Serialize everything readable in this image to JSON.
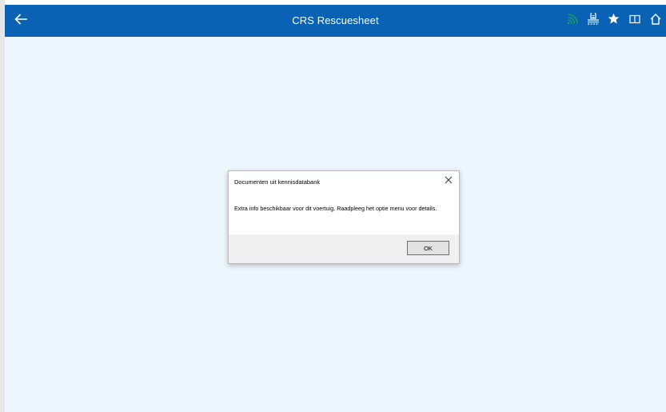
{
  "app": {
    "title": "CRS Rescuesheet",
    "accent_color": "#0a62b4",
    "background_color": "#eef6fd"
  },
  "toolbar": {
    "back_icon": "arrow-left-icon",
    "actions": [
      {
        "icon": "signal-icon",
        "color": "#1fa84f"
      },
      {
        "icon": "document-stack-icon",
        "color": "#ffffff"
      },
      {
        "icon": "star-icon",
        "color": "#ffffff"
      },
      {
        "icon": "book-icon",
        "color": "#ffffff"
      },
      {
        "icon": "home-icon",
        "color": "#ffffff"
      }
    ]
  },
  "dialog": {
    "title": "Documenten uit kennisdatabank",
    "message": "Extra info beschikbaar voor dit voertuig. Raadpleeg het optie menu voor details.",
    "ok_label": "OK",
    "close_icon": "close-icon"
  }
}
